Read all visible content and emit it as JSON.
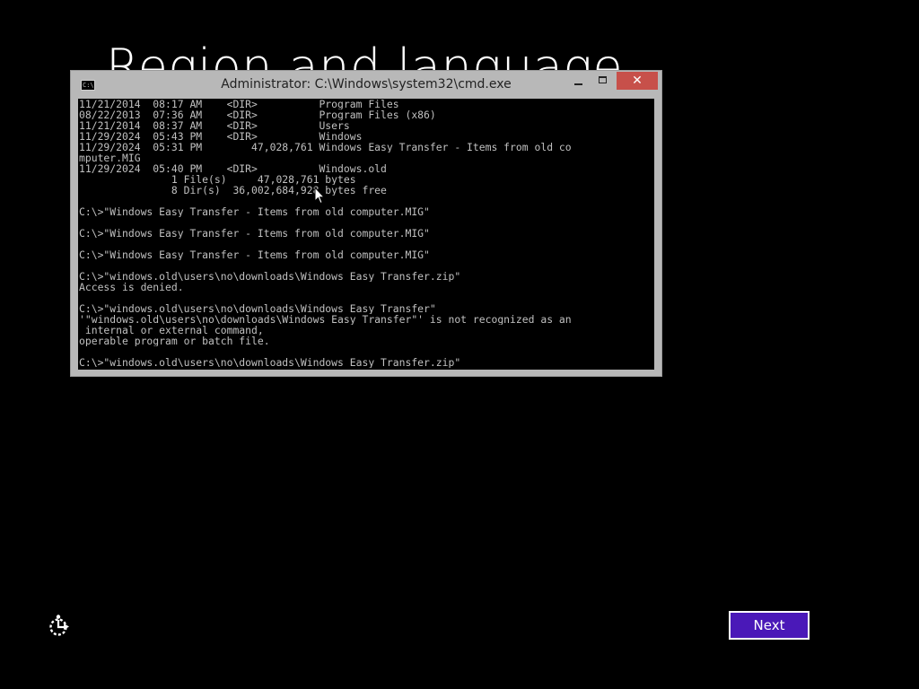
{
  "page": {
    "title": "Region and language"
  },
  "cmd_window": {
    "icon_text": "C:\\",
    "title": "Administrator: C:\\Windows\\system32\\cmd.exe",
    "minimize_glyph": "",
    "maximize_glyph": "",
    "close_glyph": "✕",
    "lines": [
      "11/21/2014  08:17 AM    <DIR>          Program Files",
      "08/22/2013  07:36 AM    <DIR>          Program Files (x86)",
      "11/21/2014  08:37 AM    <DIR>          Users",
      "11/29/2024  05:43 PM    <DIR>          Windows",
      "11/29/2024  05:31 PM        47,028,761 Windows Easy Transfer - Items from old co",
      "mputer.MIG",
      "11/29/2024  05:40 PM    <DIR>          Windows.old",
      "               1 File(s)     47,028,761 bytes",
      "               8 Dir(s)  36,002,684,928 bytes free",
      "",
      "C:\\>\"Windows Easy Transfer - Items from old computer.MIG\"",
      "",
      "C:\\>\"Windows Easy Transfer - Items from old computer.MIG\"",
      "",
      "C:\\>\"Windows Easy Transfer - Items from old computer.MIG\"",
      "",
      "C:\\>\"windows.old\\users\\no\\downloads\\Windows Easy Transfer.zip\"",
      "Access is denied.",
      "",
      "C:\\>\"windows.old\\users\\no\\downloads\\Windows Easy Transfer\"",
      "'\"windows.old\\users\\no\\downloads\\Windows Easy Transfer\"' is not recognized as an",
      " internal or external command,",
      "operable program or batch file.",
      "",
      "C:\\>\"windows.old\\users\\no\\downloads\\Windows Easy Transfer.zip\""
    ]
  },
  "footer": {
    "ease_of_access_icon": "ease-of-access-icon",
    "next_label": "Next"
  },
  "colors": {
    "background": "#000000",
    "console_text": "#c0c0c0",
    "window_frame": "#b8b8b8",
    "close_button": "#c7504a",
    "next_button": "#4a18b8"
  }
}
